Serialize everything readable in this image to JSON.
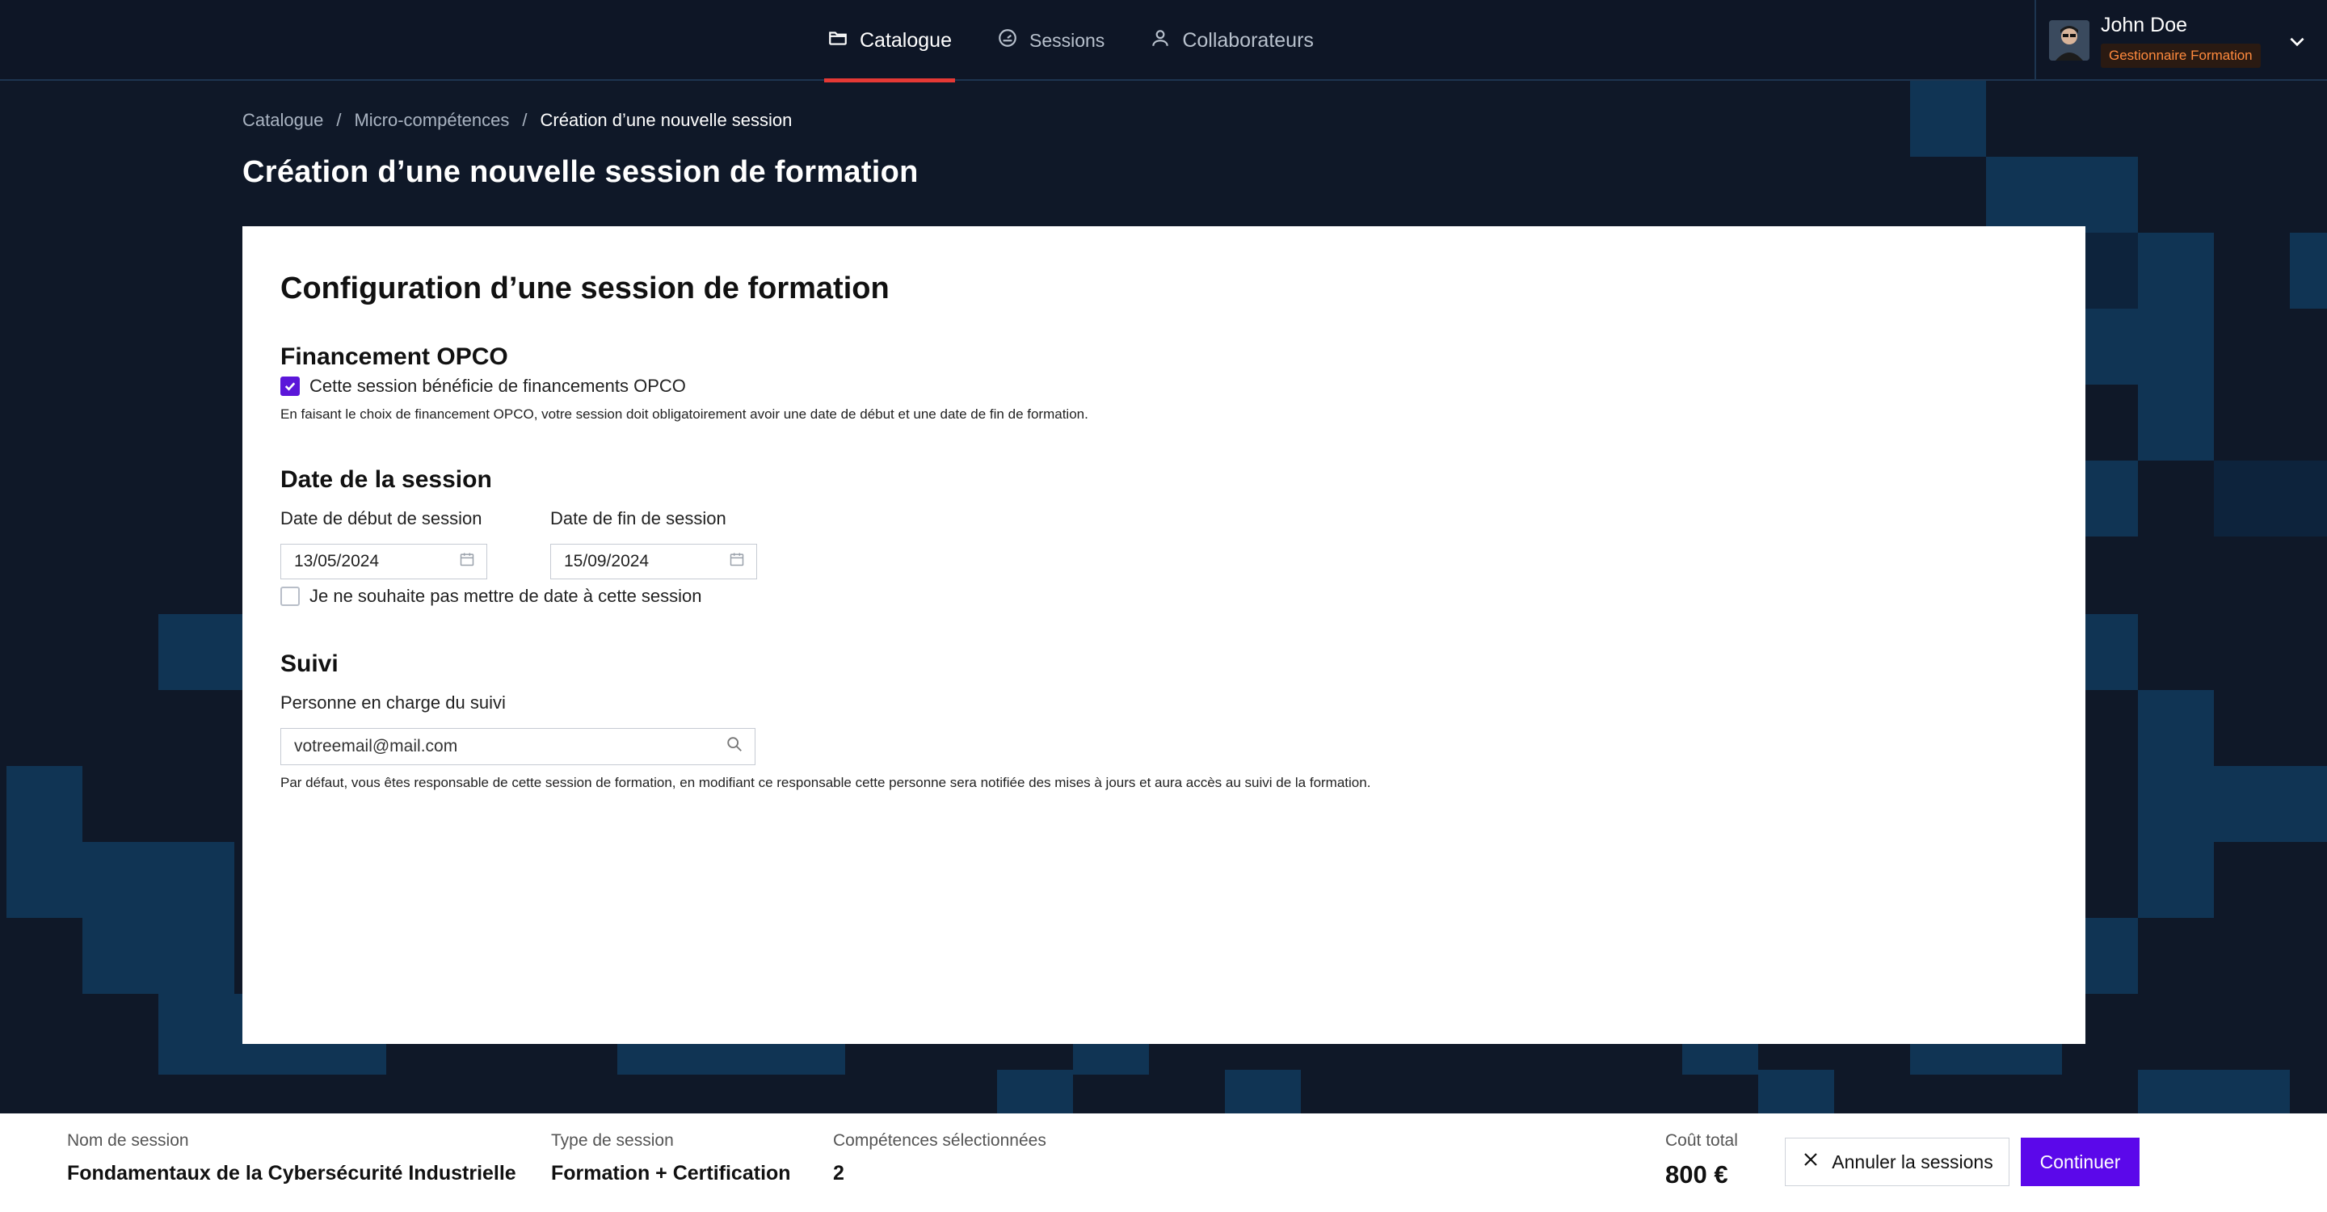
{
  "nav": {
    "items": [
      {
        "label": "Catalogue",
        "icon": "folder-icon",
        "active": true
      },
      {
        "label": "Sessions",
        "icon": "gauge-icon",
        "active": false
      },
      {
        "label": "Collaborateurs",
        "icon": "user-icon",
        "active": false
      }
    ]
  },
  "user": {
    "name": "John Doe",
    "role": "Gestionnaire Formation"
  },
  "breadcrumb": [
    "Catalogue",
    "Micro-compétences",
    "Création d’une nouvelle session"
  ],
  "page_title": "Création d’une nouvelle session de formation",
  "card": {
    "title": "Configuration d’une session de formation",
    "opco": {
      "title": "Financement OPCO",
      "checkbox_label": "Cette session bénéficie de financements OPCO",
      "checked": true,
      "helper": "En faisant le choix de financement OPCO, votre session doit obligatoirement avoir une date de début et une date de fin de formation."
    },
    "dates": {
      "title": "Date de la session",
      "start_label": "Date de début de session",
      "start_value": "13/05/2024",
      "end_label": "Date de fin de session",
      "end_value": "15/09/2024",
      "no_date_label": "Je ne souhaite pas mettre de date à cette session",
      "no_date_checked": false
    },
    "suivi": {
      "title": "Suivi",
      "field_label": "Personne en charge du suivi",
      "placeholder": "votreemail@mail.com",
      "helper": "Par défaut, vous êtes responsable de cette session de formation, en modifiant ce responsable cette personne sera notifiée des mises à jours et aura accès au suivi de la formation."
    }
  },
  "footer": {
    "session_name_label": "Nom de session",
    "session_name_value": "Fondamentaux de la Cybersécurité Industrielle",
    "session_type_label": "Type de session",
    "session_type_value": "Formation + Certification",
    "skills_label": "Compétences sélectionnées",
    "skills_value": "2",
    "cost_label": "Coût total",
    "cost_value": "800 €",
    "cancel_label": "Annuler la sessions",
    "continue_label": "Continuer"
  },
  "colors": {
    "background": "#0f1828",
    "accent_purple": "#5b08ea",
    "active_tab": "#e53935",
    "role_badge": "#ff8a3d"
  }
}
